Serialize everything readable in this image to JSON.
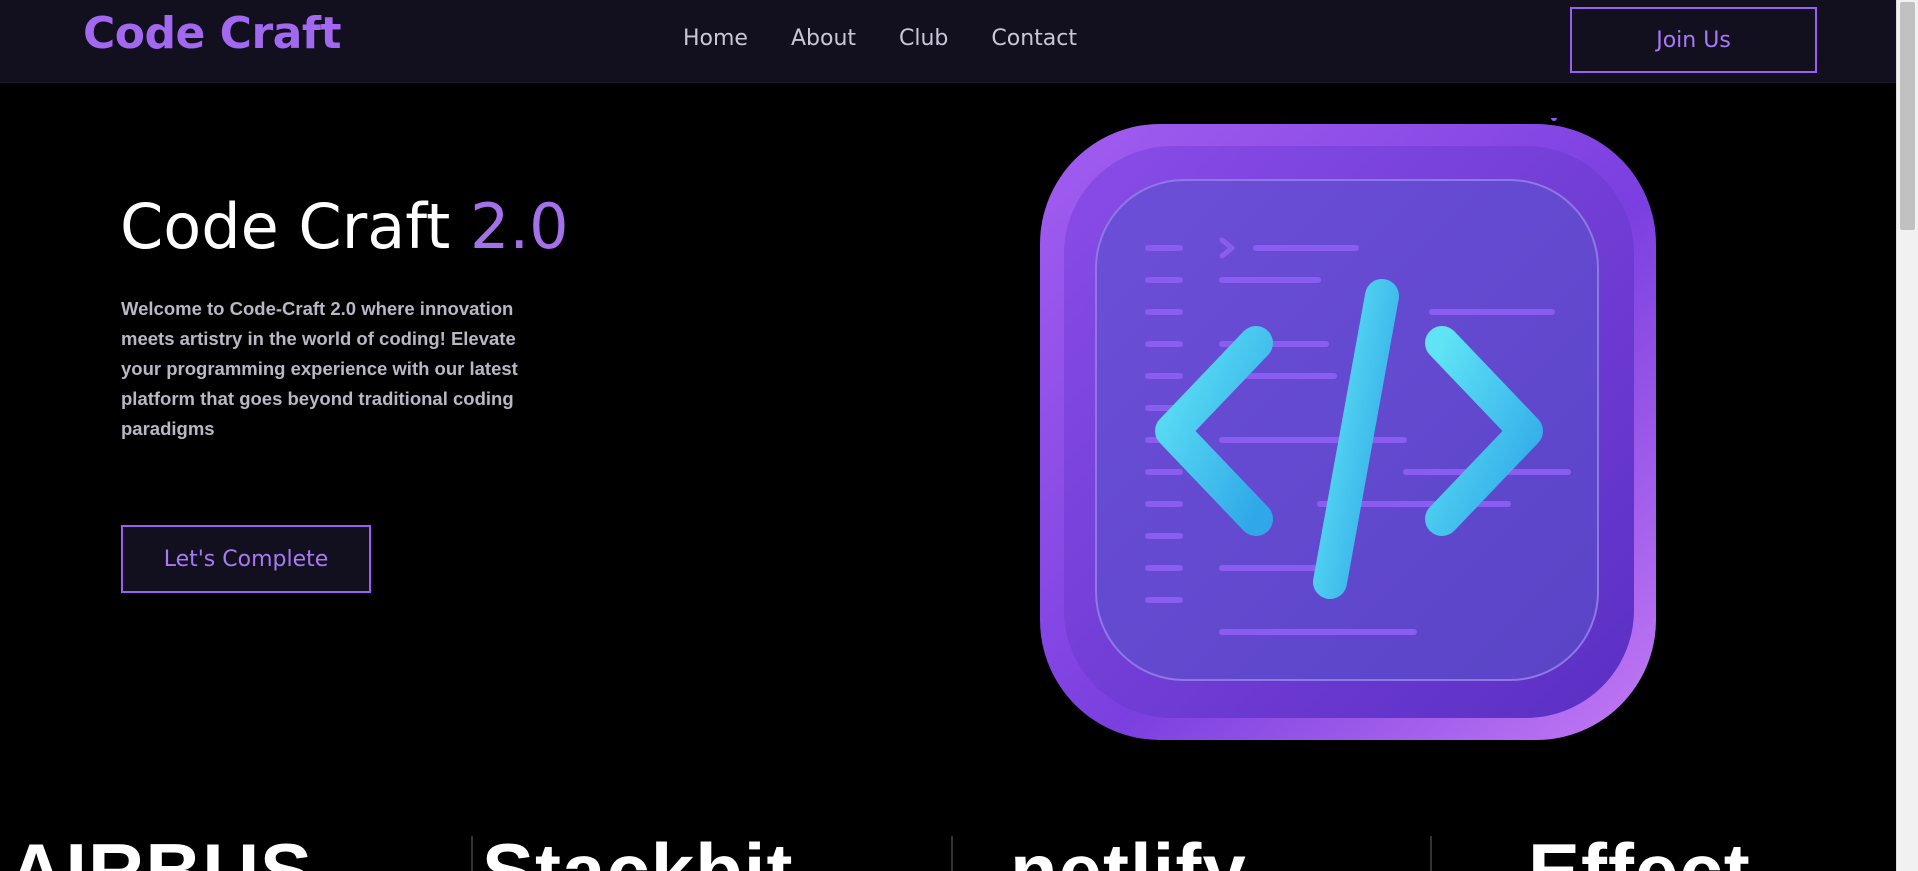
{
  "nav": {
    "brand": "Code Craft",
    "links": [
      "Home",
      "About",
      "Club",
      "Contact"
    ],
    "join_label": "Join Us"
  },
  "hero": {
    "title_main": "Code Craft",
    "title_accent": "2.0",
    "description": "Welcome to Code-Craft 2.0 where innovation meets artistry in the world of coding! Elevate your programming experience with our latest platform that goes beyond traditional coding paradigms",
    "cta_label": "Let's Complete",
    "image_icon": "code-brackets-icon"
  },
  "logos": [
    "AIRBUS",
    "Stackbit",
    "netlify",
    "Effect"
  ],
  "colors": {
    "accent": "#a268f0",
    "nav_bg": "#12101f",
    "page_bg": "#000000",
    "muted_text": "#b9b7c4"
  }
}
